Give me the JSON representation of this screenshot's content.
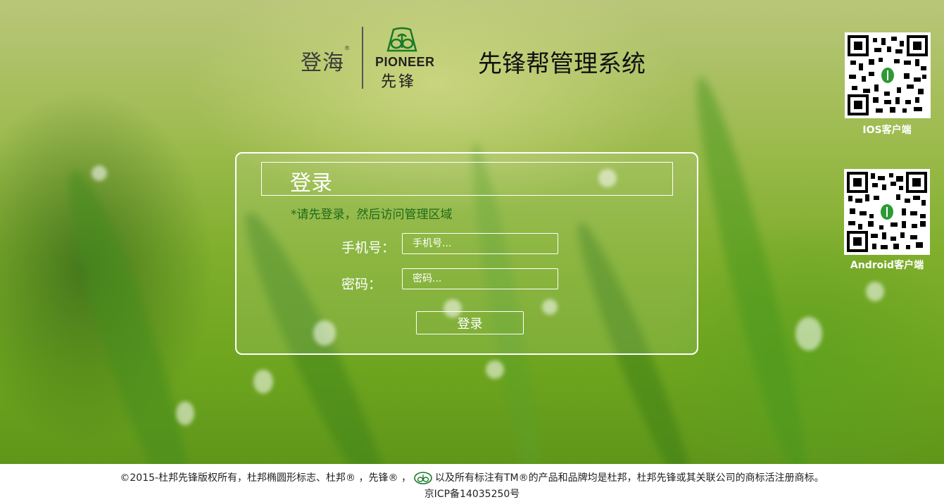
{
  "header": {
    "brand_dh": "登海",
    "brand_pioneer": "PIONEER",
    "brand_xf": "先锋",
    "system_title": "先锋帮管理系统"
  },
  "qr_codes": [
    {
      "label": "IOS客户端",
      "icon": "qr-code-icon"
    },
    {
      "label": "Android客户端",
      "icon": "qr-code-icon"
    }
  ],
  "login": {
    "title": "登录",
    "hint": "*请先登录，然后访问管理区域",
    "phone_label": "手机号：",
    "phone_placeholder": "手机号...",
    "password_label": "密码：",
    "password_placeholder": "密码...",
    "submit_label": "登录"
  },
  "footer": {
    "copyright_part1": "©2015-杜邦先锋版权所有，杜邦椭圆形标志、杜邦® ，先锋® ，",
    "copyright_part2": "以及所有标注有TM®的产品和品牌均是杜邦，杜邦先锋或其关联公司的商标活注册商标。",
    "icp": "京ICP备14035250号"
  },
  "colors": {
    "hint_green": "#1f6b1a",
    "logo_green": "#1a7a2a",
    "background_green": "#7fae2c"
  }
}
